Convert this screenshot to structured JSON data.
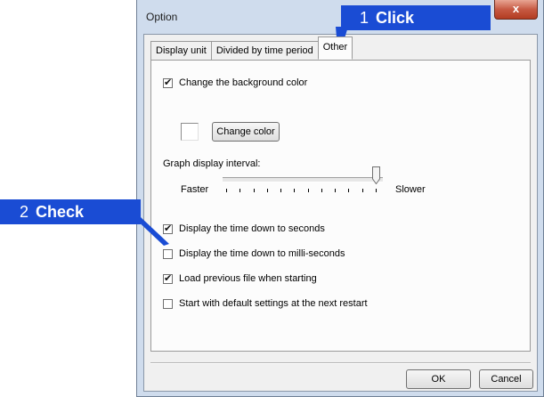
{
  "window": {
    "title": "Option",
    "close_glyph": "x"
  },
  "tabs": [
    {
      "label": "Display unit",
      "active": false
    },
    {
      "label": "Divided by time period",
      "active": false
    },
    {
      "label": "Other",
      "active": true
    }
  ],
  "other_tab": {
    "change_bg": {
      "label": "Change the background color",
      "checked": true
    },
    "current_color": "#ffffff",
    "change_color_button": "Change color",
    "graph_interval": {
      "heading": "Graph display interval:",
      "min_label": "Faster",
      "max_label": "Slower",
      "tick_count": 12,
      "position_fraction": 1.0
    },
    "options": [
      {
        "label": "Display the time down to seconds",
        "checked": true
      },
      {
        "label": "Display the time down to milli-seconds",
        "checked": false
      },
      {
        "label": "Load previous file when starting",
        "checked": true
      },
      {
        "label": "Start with default settings at the next restart",
        "checked": false
      }
    ]
  },
  "footer": {
    "ok_label": "OK",
    "cancel_label": "Cancel"
  },
  "callouts": [
    {
      "number": "1",
      "text": "Click"
    },
    {
      "number": "2",
      "text": "Check"
    }
  ],
  "colors": {
    "callout_blue": "#1a4cd4",
    "window_frame": "#cfdced",
    "close_button": "#c75a43"
  }
}
